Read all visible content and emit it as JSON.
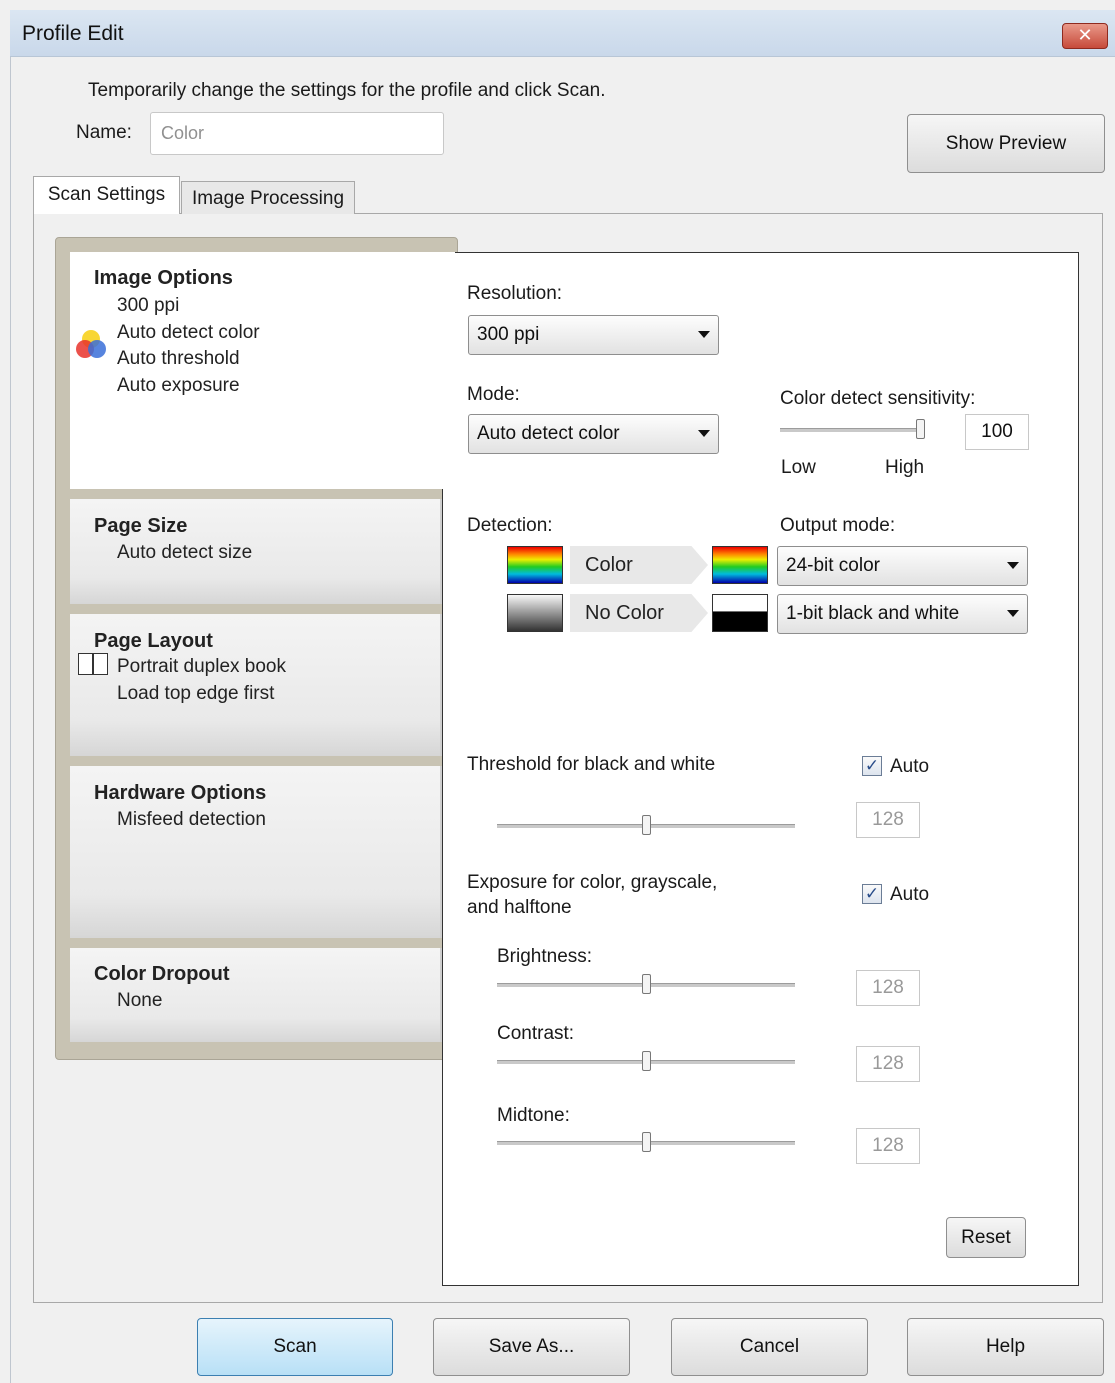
{
  "window": {
    "title": "Profile Edit",
    "close_label": "✕"
  },
  "instructions": "Temporarily change the settings for the profile and click Scan.",
  "name_field": {
    "label": "Name:",
    "value": "Color"
  },
  "show_preview_label": "Show Preview",
  "tabs": [
    {
      "label": "Scan Settings",
      "selected": true
    },
    {
      "label": "Image Processing",
      "selected": false
    }
  ],
  "cards": {
    "image_options": {
      "title": "Image Options",
      "lines": [
        "300 ppi",
        "Auto detect color",
        "Auto threshold",
        "Auto exposure"
      ],
      "icon": "color-wheel-icon"
    },
    "page_size": {
      "title": "Page Size",
      "lines": [
        "Auto detect size"
      ]
    },
    "page_layout": {
      "title": "Page Layout",
      "lines": [
        "Portrait duplex book",
        "Load top edge first"
      ],
      "icon": "book-layout-icon"
    },
    "hardware_options": {
      "title": "Hardware Options",
      "lines": [
        "Misfeed detection"
      ]
    },
    "color_dropout": {
      "title": "Color Dropout",
      "lines": [
        "None"
      ]
    }
  },
  "settings": {
    "resolution": {
      "label": "Resolution:",
      "value": "300 ppi"
    },
    "mode": {
      "label": "Mode:",
      "value": "Auto detect color"
    },
    "sensitivity": {
      "label": "Color detect sensitivity:",
      "value": "100",
      "low": "Low",
      "high": "High",
      "level": 1.0
    },
    "detection": {
      "label": "Detection:",
      "output_label": "Output mode:",
      "color_label": "Color",
      "no_color_label": "No Color",
      "color_output": "24-bit color",
      "no_color_output": "1-bit black and white"
    },
    "threshold": {
      "label": "Threshold for black and white",
      "auto_label": "Auto",
      "auto_checked": true,
      "value": "128",
      "level": 0.5
    },
    "exposure": {
      "label_line1": "Exposure for color, grayscale,",
      "label_line2": "and halftone",
      "auto_label": "Auto",
      "auto_checked": true,
      "brightness": {
        "label": "Brightness:",
        "value": "128",
        "level": 0.5
      },
      "contrast": {
        "label": "Contrast:",
        "value": "128",
        "level": 0.5
      },
      "midtone": {
        "label": "Midtone:",
        "value": "128",
        "level": 0.5
      }
    },
    "reset_label": "Reset",
    "check_mark": "✓"
  },
  "footer": {
    "scan": "Scan",
    "save_as": "Save As...",
    "cancel": "Cancel",
    "help": "Help"
  }
}
